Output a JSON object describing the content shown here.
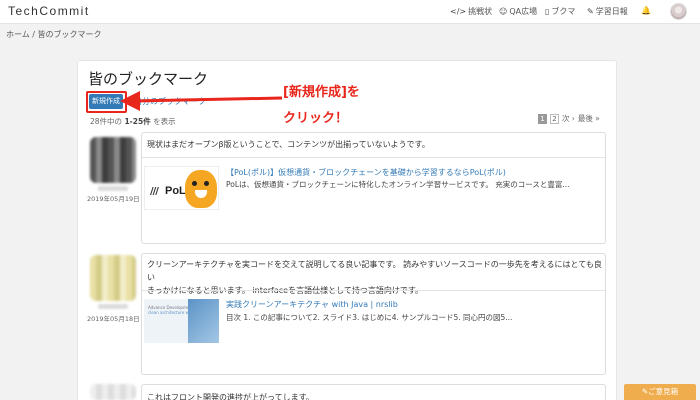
{
  "navbar": {
    "brand": "TechCommit",
    "items": [
      {
        "icon": "code-icon",
        "glyph": "</>",
        "label": "挑戦状"
      },
      {
        "icon": "chat-icon",
        "glyph": "☺",
        "label": "QA広場"
      },
      {
        "icon": "bookmark-icon",
        "glyph": "▯",
        "label": "ブクマ"
      },
      {
        "icon": "pencil-icon",
        "glyph": "✎",
        "label": "学習日報"
      }
    ],
    "bell_icon": "bell-icon",
    "bell_glyph": "🔔"
  },
  "breadcrumb": "ホーム / 皆のブックマーク",
  "page": {
    "title": "皆のブックマーク",
    "new_button": "新規作成",
    "my_bookmarks_link": "自分のブックマーク",
    "count_prefix": "28件中の",
    "count_range": "1-25件",
    "count_suffix": "を表示",
    "pager": {
      "pages": [
        "1",
        "2"
      ],
      "next": "次 ›",
      "last": "最後 »"
    }
  },
  "annotation": {
    "line1": "[新規作成]を",
    "line2": "クリック！"
  },
  "entries": [
    {
      "date": "2019年05月19日",
      "comment": "現状はまだオープンβ版ということで、コンテンツが出揃っていないようです。",
      "link_title": "【PoL(ポル)】仮想通貨・ブロックチェーンを基礎から学習するならPoL(ポル)",
      "link_desc": "PoLは、仮想通貨・ブロックチェーンに特化したオンライン学習サービスです。 充実のコースと豊富...",
      "thumb": {
        "logo": "PoL",
        "bars": "///"
      }
    },
    {
      "date": "2019年05月18日",
      "comment_line1": "クリーンアーキテクチャを実コードを交えて説明してる良い記事です。 読みやすいソースコードの一歩先を考えるにはとても良い",
      "comment_line2": "きっかけになると思います。 interfaceを言語仕様として持つ言語向けです。",
      "link_title": "実践クリーンアーキテクチャ with Java | nrslib",
      "link_desc": "目次 1. この記事について2. スライド3. はじめに4. サンプルコード5. 同心円の図5...",
      "thumb": {
        "line1": "Advance Development",
        "line2": "clean architecture with Java"
      }
    },
    {
      "comment": "これはフロント開発の進捗が上がってします。"
    }
  ],
  "opinion_button": "✎ご意見箱",
  "colors": {
    "primary": "#337ab7",
    "annotation_red": "#e8261c",
    "opinion": "#f0ad4e"
  }
}
